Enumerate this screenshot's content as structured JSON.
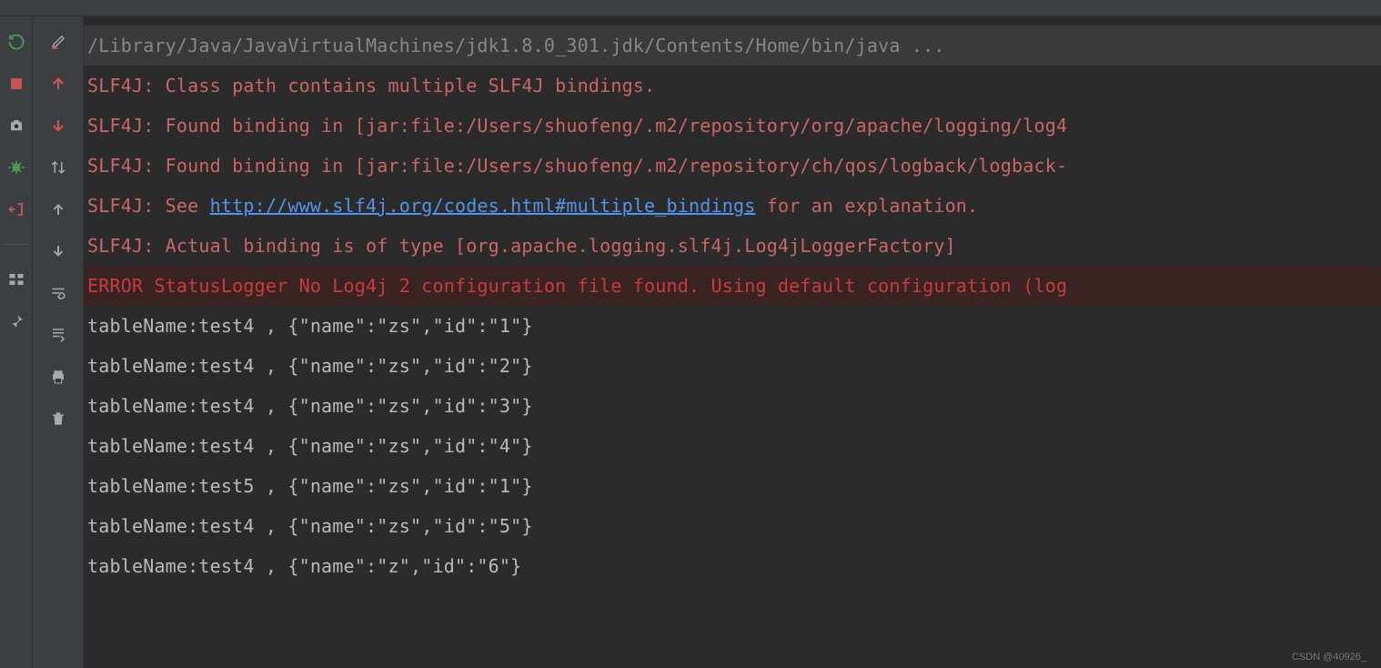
{
  "gutterA": {
    "rerun": "rerun-icon",
    "stop": "stop-icon",
    "camera": "camera-icon",
    "bug": "bug-icon",
    "exit": "exit-icon",
    "layout": "layout-icon",
    "pin": "pin-icon"
  },
  "gutterB": {
    "edit": "edit-icon",
    "up": "arrow-up-icon",
    "down": "arrow-down-icon",
    "sort": "sort-icon",
    "upEnd": "arrow-up-end-icon",
    "downEnd": "arrow-down-end-icon",
    "wrap": "wrap-icon",
    "scrollEnd": "scroll-end-icon",
    "print": "print-icon",
    "trash": "trash-icon"
  },
  "console": {
    "cmd": "/Library/Java/JavaVirtualMachines/jdk1.8.0_301.jdk/Contents/Home/bin/java ...",
    "lines": [
      {
        "type": "warn",
        "text": "SLF4J: Class path contains multiple SLF4J bindings."
      },
      {
        "type": "warn",
        "text": "SLF4J: Found binding in [jar:file:/Users/shuofeng/.m2/repository/org/apache/logging/log4"
      },
      {
        "type": "warn",
        "text": "SLF4J: Found binding in [jar:file:/Users/shuofeng/.m2/repository/ch/qos/logback/logback-"
      },
      {
        "type": "warnlink",
        "pre": "SLF4J: See ",
        "link": "http://www.slf4j.org/codes.html#multiple_bindings",
        "post": " for an explanation."
      },
      {
        "type": "warn",
        "text": "SLF4J: Actual binding is of type [org.apache.logging.slf4j.Log4jLoggerFactory]"
      },
      {
        "type": "err",
        "text": "ERROR StatusLogger No Log4j 2 configuration file found. Using default configuration (log"
      },
      {
        "type": "out",
        "text": "tableName:test4 , {\"name\":\"zs\",\"id\":\"1\"}"
      },
      {
        "type": "out",
        "text": "tableName:test4 , {\"name\":\"zs\",\"id\":\"2\"}"
      },
      {
        "type": "out",
        "text": "tableName:test4 , {\"name\":\"zs\",\"id\":\"3\"}"
      },
      {
        "type": "out",
        "text": "tableName:test4 , {\"name\":\"zs\",\"id\":\"4\"}"
      },
      {
        "type": "out",
        "text": "tableName:test5 , {\"name\":\"zs\",\"id\":\"1\"}"
      },
      {
        "type": "out",
        "text": "tableName:test4 , {\"name\":\"zs\",\"id\":\"5\"}"
      },
      {
        "type": "out",
        "text": "tableName:test4 , {\"name\":\"z\",\"id\":\"6\"}"
      }
    ]
  },
  "watermark": "CSDN @40926_"
}
